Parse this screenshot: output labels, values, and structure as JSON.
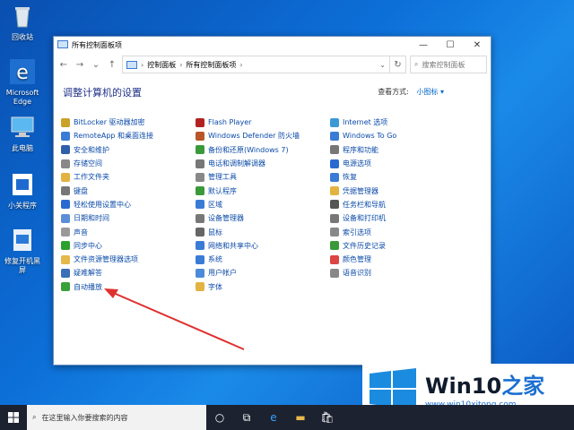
{
  "desktop": {
    "icons": [
      {
        "label": "回收站",
        "icon": "recycle-bin-icon"
      },
      {
        "label": "Microsoft Edge",
        "icon": "edge-icon"
      },
      {
        "label": "此电脑",
        "icon": "computer-icon"
      },
      {
        "label": "小关程序",
        "icon": "app-icon"
      },
      {
        "label": "修复开机黑屏",
        "icon": "repair-icon"
      }
    ]
  },
  "window": {
    "title": "所有控制面板项",
    "breadcrumb": [
      "控制面板",
      "所有控制面板项"
    ],
    "search_placeholder": "搜索控制面板",
    "heading": "调整计算机的设置",
    "view_by_label": "查看方式:",
    "view_by_value": "小图标 ▾",
    "columns": [
      [
        {
          "label": "BitLocker 驱动器加密",
          "color": "#c9a227"
        },
        {
          "label": "RemoteApp 和桌面连接",
          "color": "#3a7bd5"
        },
        {
          "label": "安全和维护",
          "color": "#2f5fa8"
        },
        {
          "label": "存储空间",
          "color": "#888888"
        },
        {
          "label": "工作文件夹",
          "color": "#e3b341"
        },
        {
          "label": "键盘",
          "color": "#777777"
        },
        {
          "label": "轻松使用设置中心",
          "color": "#2a6ad0"
        },
        {
          "label": "日期和时间",
          "color": "#5a8fd8"
        },
        {
          "label": "声音",
          "color": "#999999"
        },
        {
          "label": "同步中心",
          "color": "#2ca02c"
        },
        {
          "label": "文件资源管理器选项",
          "color": "#e5b84a"
        },
        {
          "label": "疑难解答",
          "color": "#3b6fb6"
        },
        {
          "label": "自动播放",
          "color": "#3aa03a"
        }
      ],
      [
        {
          "label": "Flash Player",
          "color": "#b22222"
        },
        {
          "label": "Windows Defender 防火墙",
          "color": "#b8562a"
        },
        {
          "label": "备份和还原(Windows 7)",
          "color": "#3a9a3a"
        },
        {
          "label": "电话和调制解调器",
          "color": "#777777"
        },
        {
          "label": "管理工具",
          "color": "#888888"
        },
        {
          "label": "默认程序",
          "color": "#3a9a3a"
        },
        {
          "label": "区域",
          "color": "#3a7bd5"
        },
        {
          "label": "设备管理器",
          "color": "#777777"
        },
        {
          "label": "鼠标",
          "color": "#666666"
        },
        {
          "label": "网络和共享中心",
          "color": "#3a7bd5"
        },
        {
          "label": "系统",
          "color": "#3a7bd5"
        },
        {
          "label": "用户帐户",
          "color": "#4a8ad8"
        },
        {
          "label": "字体",
          "color": "#e3b341"
        }
      ],
      [
        {
          "label": "Internet 选项",
          "color": "#3a9ad5"
        },
        {
          "label": "Windows To Go",
          "color": "#3a7bd5"
        },
        {
          "label": "程序和功能",
          "color": "#777777"
        },
        {
          "label": "电源选项",
          "color": "#2a6ad0"
        },
        {
          "label": "恢复",
          "color": "#3a7bd5"
        },
        {
          "label": "凭据管理器",
          "color": "#e3b341"
        },
        {
          "label": "任务栏和导航",
          "color": "#555555"
        },
        {
          "label": "设备和打印机",
          "color": "#777777"
        },
        {
          "label": "索引选项",
          "color": "#888888"
        },
        {
          "label": "文件历史记录",
          "color": "#3a9a3a"
        },
        {
          "label": "颜色管理",
          "color": "#d44"
        },
        {
          "label": "语音识别",
          "color": "#888888"
        }
      ]
    ]
  },
  "logo": {
    "brand_prefix": "Win10",
    "brand_suffix": "之家",
    "url": "www.win10xitong.com"
  },
  "taskbar": {
    "search_placeholder": "在这里输入你要搜索的内容"
  },
  "colors": {
    "accent": "#0078d7",
    "link": "#0a4aa8",
    "heading": "#1e3287"
  }
}
